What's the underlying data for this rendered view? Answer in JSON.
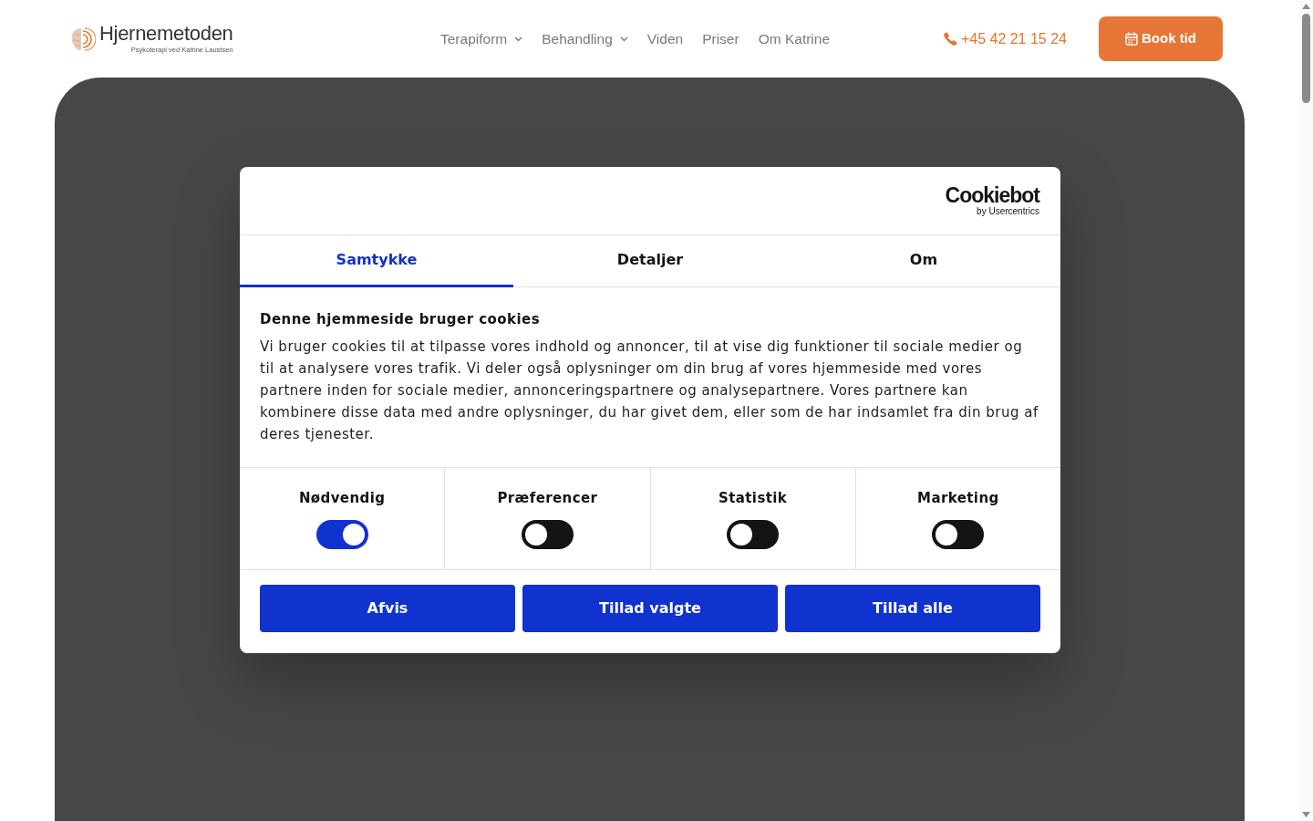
{
  "header": {
    "logo": {
      "name": "Hjernemetoden",
      "tagline": "Psykoterapi ved Katrine Laustsen"
    },
    "nav": [
      {
        "label": "Terapiform",
        "dropdown": true
      },
      {
        "label": "Behandling",
        "dropdown": true
      },
      {
        "label": "Viden",
        "dropdown": false
      },
      {
        "label": "Priser",
        "dropdown": false
      },
      {
        "label": "Om Katrine",
        "dropdown": false
      }
    ],
    "phone": "+45 42 21 15 24",
    "book_button": "Book tid"
  },
  "cookie_dialog": {
    "brand": {
      "name": "Cookiebot",
      "by": "by Usercentrics"
    },
    "tabs": [
      {
        "label": "Samtykke",
        "selected": true
      },
      {
        "label": "Detaljer",
        "selected": false
      },
      {
        "label": "Om",
        "selected": false
      }
    ],
    "heading": "Denne hjemmeside bruger cookies",
    "text": "Vi bruger cookies til at tilpasse vores indhold og annoncer, til at vise dig funktioner til sociale medier og til at analysere vores trafik. Vi deler også oplysninger om din brug af vores hjemmeside med vores partnere inden for sociale medier, annonceringspartnere og analysepartnere. Vores partnere kan kombinere disse data med andre oplysninger, du har givet dem, eller som de har indsamlet fra din brug af deres tjenester.",
    "categories": [
      {
        "label": "Nødvendig",
        "on": true
      },
      {
        "label": "Præferencer",
        "on": false
      },
      {
        "label": "Statistik",
        "on": false
      },
      {
        "label": "Marketing",
        "on": false
      }
    ],
    "buttons": [
      "Afvis",
      "Tillad valgte",
      "Tillad alle"
    ]
  }
}
